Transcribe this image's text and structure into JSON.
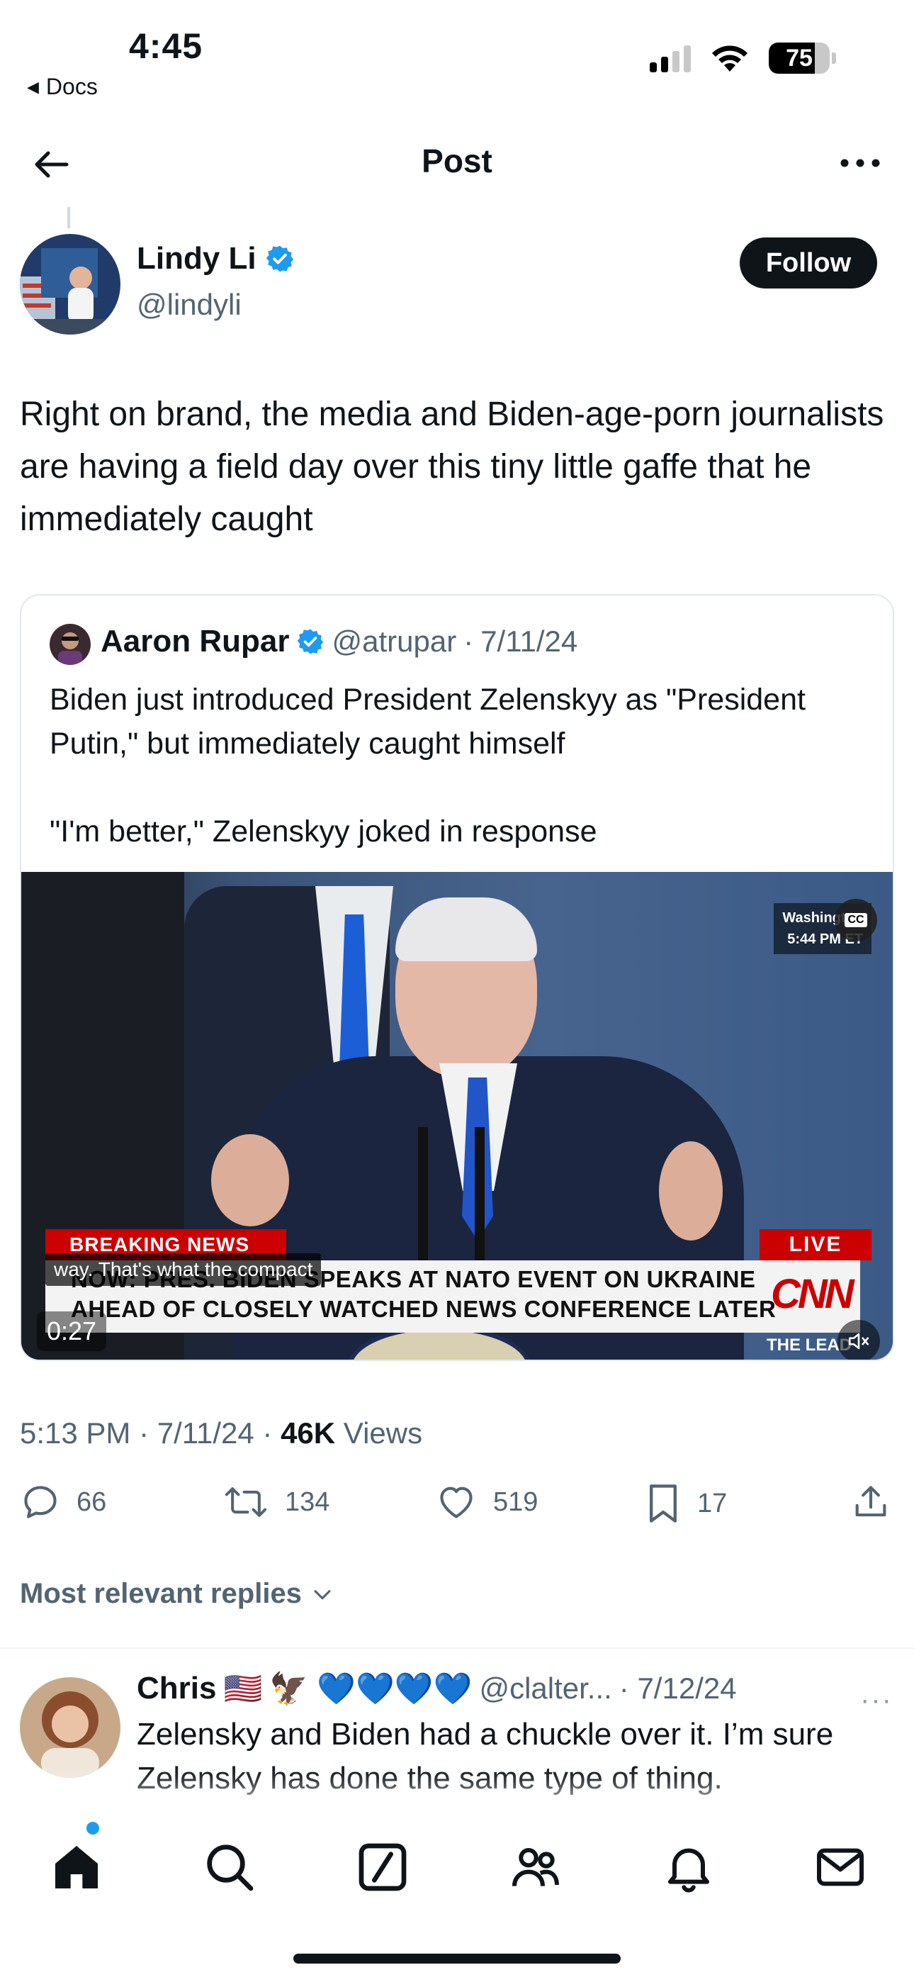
{
  "status_bar": {
    "time": "4:45",
    "back_app": "Docs",
    "battery": "75",
    "battery_level": 0.75
  },
  "header": {
    "title": "Post",
    "back_icon": "arrow-left-icon",
    "more_icon": "more-horizontal-icon"
  },
  "post": {
    "author_name": "Lindy Li",
    "author_handle": "@lindyli",
    "verified": true,
    "follow_label": "Follow",
    "text": "Right on brand, the media and Biden-age-porn journalists are having a field day over this tiny little gaffe that he immediately caught",
    "timestamp": "5:13 PM · 7/11/24 · ",
    "views_count": "46K",
    "views_label": " Views"
  },
  "quote": {
    "author_name": "Aaron Rupar",
    "author_handle": "@atrupar",
    "dot": "·",
    "date": "7/11/24",
    "text": "Biden just introduced President Zelenskyy as \"President Putin,\" but immediately caught himself\n\n\"I'm better,\" Zelenskyy joked in response",
    "video": {
      "location": "Washington",
      "time_et": "5:44 PM ET",
      "cc": "CC",
      "breaking": "BREAKING NEWS",
      "caption": "way. That's what the compact",
      "ticker_line1": "NOW: PRES. BIDEN SPEAKS AT NATO EVENT ON UKRAINE",
      "ticker_line2": "AHEAD OF CLOSELY WATCHED NEWS CONFERENCE LATER",
      "live": "LIVE",
      "network": "CNN",
      "show": "THE LEAD",
      "duration": "0:27"
    }
  },
  "actions": {
    "replies": "66",
    "reposts": "134",
    "likes": "519",
    "bookmarks": "17"
  },
  "replies_sort": "Most relevant replies",
  "reply": {
    "author_name": "Chris",
    "flag": "🇺🇸",
    "emojis": "🦅 💙💙💙💙",
    "author_handle": "@clalter...",
    "date": "· 7/12/24",
    "more": "···",
    "text": "Zelensky and Biden had a chuckle over it.  I’m sure Zelensky has done the same type of thing."
  },
  "colors": {
    "accent": "#1d9bf0",
    "text": "#0f1419",
    "secondary": "#536471",
    "breaking_red": "#cc0000"
  },
  "tabbar": [
    "home-icon",
    "search-icon",
    "grok-icon",
    "communities-icon",
    "notifications-icon",
    "messages-icon"
  ]
}
